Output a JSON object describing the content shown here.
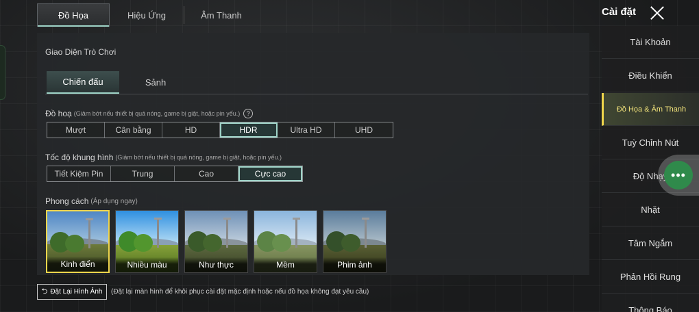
{
  "header": {
    "tabs": [
      "Đồ Họa",
      "Hiệu Ứng",
      "Âm Thanh"
    ],
    "title": "Cài đặt"
  },
  "panel": {
    "section_title": "Giao Diện Trò Chơi",
    "sub_tabs": [
      "Chiến đấu",
      "Sảnh"
    ],
    "graphics": {
      "label": "Đồ hoạ",
      "hint": "(Giảm bớt nếu thiết bị quá nóng, game bị giật, hoặc pin yếu.)",
      "options": [
        "Mượt",
        "Cân bằng",
        "HD",
        "HDR",
        "Ultra HD",
        "UHD"
      ],
      "selected": "HDR"
    },
    "frame_rate": {
      "label": "Tốc độ khung hình",
      "hint": "(Giảm bớt nếu thiết bị quá nóng, game bị giật, hoặc pin yếu.)",
      "options": [
        "Tiết Kiệm Pin",
        "Trung",
        "Cao",
        "Cực cao"
      ],
      "selected": "Cực cao"
    },
    "style": {
      "label": "Phong cách",
      "hint": "(Áp dụng ngay)",
      "options": [
        "Kinh điển",
        "Nhiều màu",
        "Như thực",
        "Mềm",
        "Phim ảnh"
      ],
      "selected": "Kinh điển"
    }
  },
  "footer": {
    "reset_label": "Đặt Lại Hình Ảnh",
    "reset_note": "(Đặt lại màn hình để khôi phục cài đặt mặc định hoặc nếu đồ họa không đạt yêu cầu)"
  },
  "sidebar": {
    "items": [
      "Tài Khoản",
      "Điều Khiển",
      "Đồ Họa & Âm Thanh",
      "Tuỳ Chỉnh Nút",
      "Độ Nhạy",
      "Nhặt",
      "Tâm Ngắm",
      "Phản Hồi Rung",
      "Thông Báo"
    ],
    "active": "Đồ Họa & Âm Thanh"
  },
  "floating_button": {
    "glyph": "•••"
  },
  "colors": {
    "accent": "#9fd4c8",
    "highlight": "#f0d64c",
    "fab": "#2f8a4b"
  }
}
